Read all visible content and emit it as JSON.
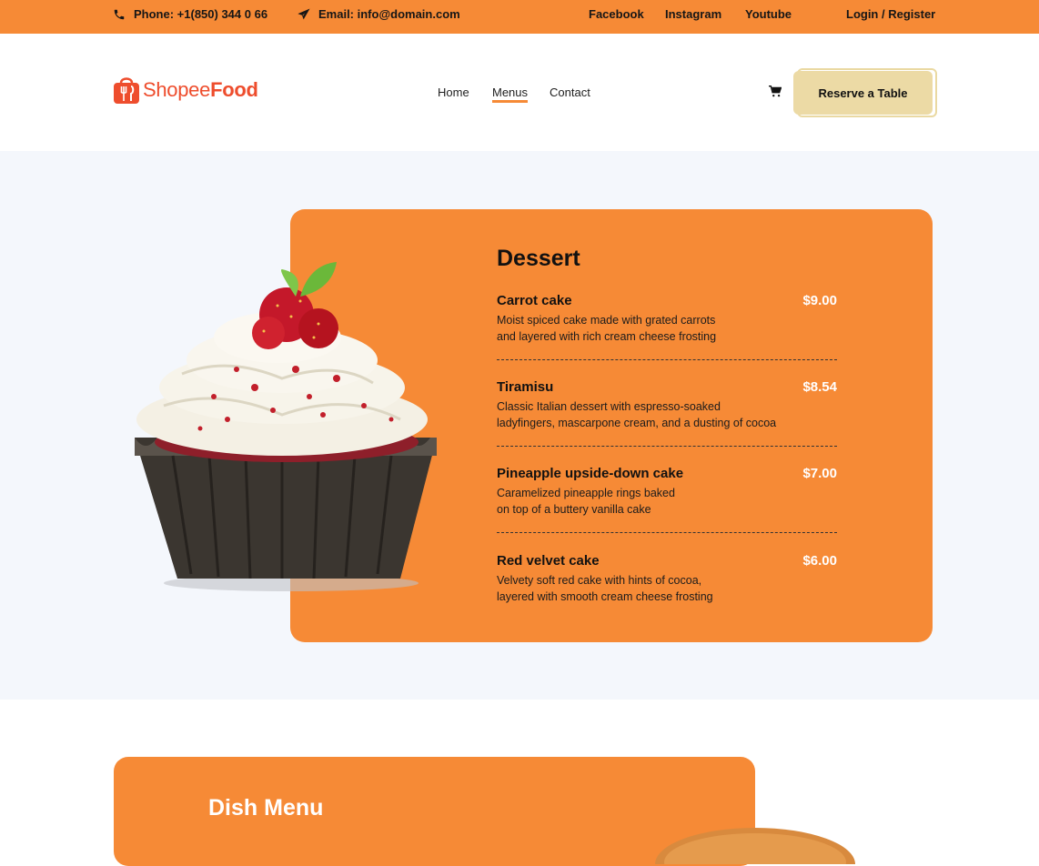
{
  "topbar": {
    "phone": "Phone: +1(850) 344 0 66",
    "email": "Email: info@domain.com",
    "social": [
      "Facebook",
      "Instagram",
      "Youtube"
    ],
    "login": "Login / Register"
  },
  "header": {
    "brand_a": "Shopee",
    "brand_b": "Food",
    "nav": [
      "Home",
      "Menus",
      "Contact"
    ],
    "active_nav": "Menus",
    "reserve_label": "Reserve a Table"
  },
  "dessert": {
    "title": "Dessert",
    "items": [
      {
        "name": "Carrot cake",
        "price": "$9.00",
        "desc1": "Moist spiced cake made with grated carrots",
        "desc2": "and layered with rich cream cheese frosting"
      },
      {
        "name": "Tiramisu",
        "price": "$8.54",
        "desc1": "Classic Italian dessert with espresso-soaked",
        "desc2": "ladyfingers, mascarpone cream, and a dusting of cocoa"
      },
      {
        "name": "Pineapple upside-down cake",
        "price": "$7.00",
        "desc1": "Caramelized pineapple rings baked",
        "desc2": "on top of a buttery vanilla cake"
      },
      {
        "name": "Red velvet cake",
        "price": "$6.00",
        "desc1": "Velvety soft red cake with hints of cocoa,",
        "desc2": "layered with smooth cream cheese frosting"
      }
    ]
  },
  "dish": {
    "title": "Dish Menu"
  },
  "colors": {
    "accent": "#f68a36",
    "brand": "#ee4d2d",
    "reserve_bg": "#ecdaa5",
    "section_bg": "#f4f7fc"
  },
  "icons": [
    "phone-icon",
    "paper-plane-icon",
    "shopping-cart-icon",
    "shopee-bag-logo"
  ]
}
